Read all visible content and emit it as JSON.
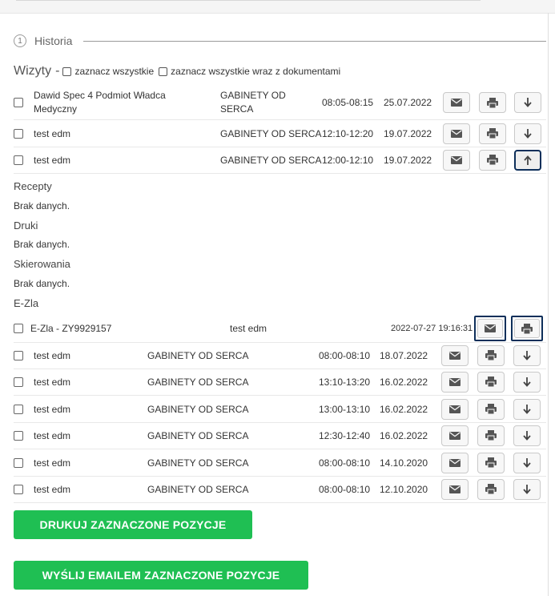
{
  "section": {
    "number": "1",
    "title": "Historia"
  },
  "visits_header": {
    "title": "Wizyty",
    "dash": "-",
    "select_all": "zaznacz wszystkie",
    "select_all_docs": "zaznacz wszystkie wraz z dokumentami"
  },
  "visits_top": [
    {
      "name": "Dawid Spec 4 Podmiot Władca Medyczny",
      "clinic": "GABINETY OD SERCA",
      "time": "08:05-08:15",
      "date": "25.07.2022",
      "toggle": "down"
    },
    {
      "name": "test edm",
      "clinic": "GABINETY OD SERCA",
      "time": "12:10-12:20",
      "date": "19.07.2022",
      "toggle": "down"
    },
    {
      "name": "test edm",
      "clinic": "GABINETY OD SERCA",
      "time": "12:00-12:10",
      "date": "19.07.2022",
      "toggle": "up"
    }
  ],
  "details": {
    "recepty": "Recepty",
    "recepty_empty": "Brak danych.",
    "druki": "Druki",
    "druki_empty": "Brak danych.",
    "skierowania": "Skierowania",
    "skierowania_empty": "Brak danych.",
    "ezla": "E-Zla",
    "ezla_row": {
      "name": "E-Zla - ZY9929157",
      "doctor": "test edm",
      "datetime": "2022-07-27 19:16:31"
    }
  },
  "visits_bottom": [
    {
      "name": "test edm",
      "clinic": "GABINETY OD SERCA",
      "time": "08:00-08:10",
      "date": "18.07.2022"
    },
    {
      "name": "test edm",
      "clinic": "GABINETY OD SERCA",
      "time": "13:10-13:20",
      "date": "16.02.2022"
    },
    {
      "name": "test edm",
      "clinic": "GABINETY OD SERCA",
      "time": "13:00-13:10",
      "date": "16.02.2022"
    },
    {
      "name": "test edm",
      "clinic": "GABINETY OD SERCA",
      "time": "12:30-12:40",
      "date": "16.02.2022"
    },
    {
      "name": "test edm",
      "clinic": "GABINETY OD SERCA",
      "time": "08:00-08:10",
      "date": "14.10.2020"
    },
    {
      "name": "test edm",
      "clinic": "GABINETY OD SERCA",
      "time": "08:00-08:10",
      "date": "12.10.2020"
    }
  ],
  "actions": {
    "print_selected": "DRUKUJ ZAZNACZONE POZYCJE",
    "email_selected": "WYŚLIJ EMAILEM ZAZNACZONE POZYCJE"
  },
  "colors": {
    "green_button": "#1fbf53",
    "highlight_border": "#0e2f5a"
  },
  "icons": {
    "email": "envelope-icon",
    "print": "printer-icon",
    "expand": "arrow-down-icon",
    "collapse": "arrow-up-icon"
  }
}
